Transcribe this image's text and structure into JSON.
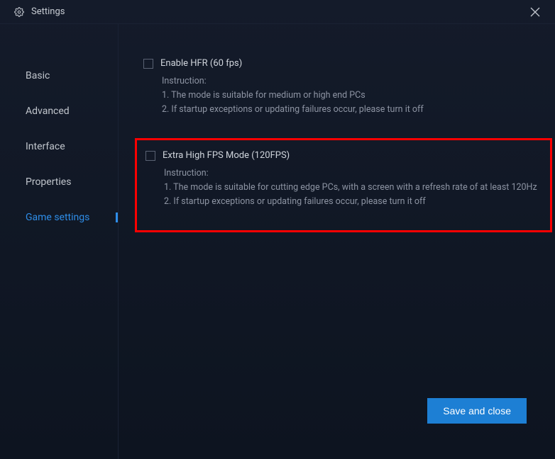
{
  "title": "Settings",
  "sidebar": {
    "items": [
      {
        "label": "Basic"
      },
      {
        "label": "Advanced"
      },
      {
        "label": "Interface"
      },
      {
        "label": "Properties"
      },
      {
        "label": "Game settings"
      }
    ]
  },
  "content": {
    "option1": {
      "label": "Enable HFR (60 fps)",
      "instruction_heading": "Instruction:",
      "line1": "1. The mode is suitable for medium or high end PCs",
      "line2": "2. If startup exceptions or updating failures occur, please turn it off"
    },
    "option2": {
      "label": "Extra High FPS Mode (120FPS)",
      "instruction_heading": "Instruction:",
      "line1": "1. The mode is suitable for cutting edge PCs, with a screen with a refresh rate of at least 120Hz",
      "line2": "2. If startup exceptions or updating failures occur, please turn it off"
    }
  },
  "footer": {
    "save_label": "Save and close"
  }
}
